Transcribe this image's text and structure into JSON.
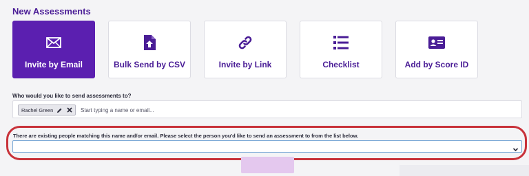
{
  "header": {
    "title": "New Assessments"
  },
  "options": [
    {
      "label": "Invite by Email",
      "icon": "envelope-icon",
      "active": true
    },
    {
      "label": "Bulk Send by CSV",
      "icon": "file-upload-icon",
      "active": false
    },
    {
      "label": "Invite by Link",
      "icon": "link-icon",
      "active": false
    },
    {
      "label": "Checklist",
      "icon": "checklist-icon",
      "active": false
    },
    {
      "label": "Add by Score ID",
      "icon": "id-card-icon",
      "active": false
    }
  ],
  "recipients": {
    "question": "Who would you like to send assessments to?",
    "chips": [
      {
        "name": "Rachel Green"
      }
    ],
    "input_value": "",
    "input_placeholder": "Start typing a name or email..."
  },
  "match": {
    "message": "There are existing people matching this name and/or email. Please select the person you'd like to send an assessment to from the list below.",
    "selected_value": ""
  },
  "colors": {
    "brand": "#5b1fb0",
    "highlight_ring": "#c8323a",
    "select_border": "#7aa8d6"
  }
}
